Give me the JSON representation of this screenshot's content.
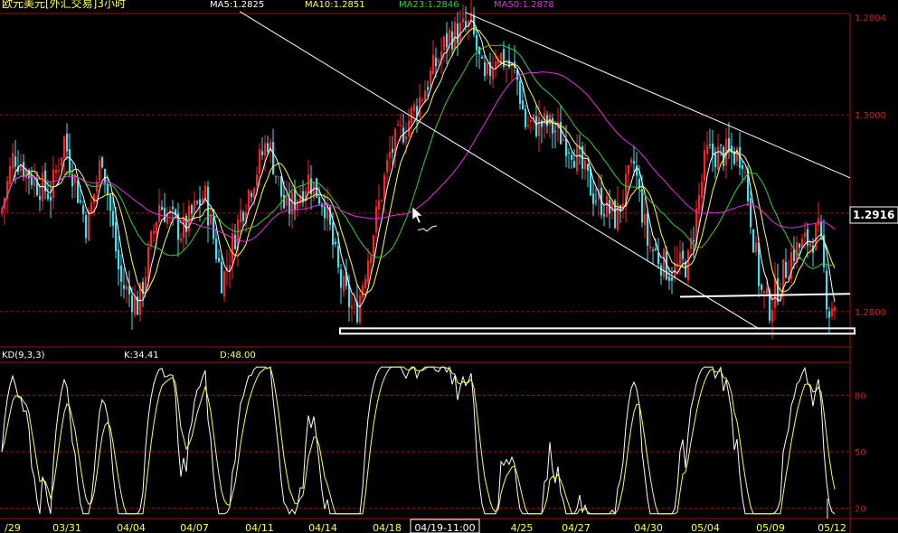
{
  "header": {
    "title": "欧元美元[外汇交易]3小时",
    "ma5": "MA5:1.2825",
    "ma10": "MA10:1.2851",
    "ma23": "MA23:1.2846",
    "ma50": "MA50:1.2878"
  },
  "kd_header": {
    "label": "KD(9,3,3)",
    "k": "K:34.41",
    "d": "D:48.00"
  },
  "colors": {
    "background": "#000000",
    "up": "#ff2020",
    "down": "#40e0f0",
    "ma5": "#ffffff",
    "ma10": "#ffff40",
    "ma23": "#30d030",
    "ma50": "#e030e0",
    "grid": "#a01010",
    "axis_text": "#c02020",
    "trendline": "#ffffff"
  },
  "cursor_label": "04/19-11:00",
  "chart_data": [
    {
      "type": "candlestick",
      "title": "欧元美元[外汇交易]3小时",
      "y_ticks": [
        "1.3000",
        "1.2800"
      ],
      "y_tick_values": [
        1.3,
        1.28
      ],
      "ylim": [
        1.2765,
        1.3102
      ],
      "price_labels": {
        "top": "1.2804",
        "current": "1.2916"
      },
      "x_ticks": [
        "/29",
        "03/31",
        "04/04",
        "04/07",
        "04/11",
        "04/14",
        "04/18",
        "04/19-11:00",
        "4/25",
        "04/27",
        "04/30",
        "05/04",
        "05/09",
        "05/12"
      ],
      "anchors": [
        [
          0,
          1.29
        ],
        [
          14,
          1.296
        ],
        [
          40,
          1.293
        ],
        [
          55,
          1.292
        ],
        [
          70,
          1.2975
        ],
        [
          95,
          1.2885
        ],
        [
          112,
          1.296
        ],
        [
          132,
          1.283
        ],
        [
          152,
          1.2805
        ],
        [
          175,
          1.291
        ],
        [
          200,
          1.288
        ],
        [
          225,
          1.292
        ],
        [
          245,
          1.283
        ],
        [
          265,
          1.29
        ],
        [
          295,
          1.2975
        ],
        [
          315,
          1.29
        ],
        [
          340,
          1.2935
        ],
        [
          358,
          1.291
        ],
        [
          375,
          1.283
        ],
        [
          392,
          1.2795
        ],
        [
          402,
          1.284
        ],
        [
          430,
          1.296
        ],
        [
          460,
          1.301
        ],
        [
          495,
          1.308
        ],
        [
          520,
          1.309
        ],
        [
          535,
          1.303
        ],
        [
          548,
          1.3065
        ],
        [
          570,
          1.304
        ],
        [
          580,
          1.299
        ],
        [
          605,
          1.299
        ],
        [
          630,
          1.297
        ],
        [
          655,
          1.292
        ],
        [
          680,
          1.2895
        ],
        [
          700,
          1.295
        ],
        [
          715,
          1.287
        ],
        [
          740,
          1.284
        ],
        [
          760,
          1.285
        ],
        [
          780,
          1.296
        ],
        [
          805,
          1.296
        ],
        [
          820,
          1.296
        ],
        [
          840,
          1.282
        ],
        [
          850,
          1.2805
        ],
        [
          875,
          1.286
        ],
        [
          905,
          1.288
        ],
        [
          915,
          1.28
        ],
        [
          922,
          1.281
        ]
      ],
      "trendlines": [
        {
          "name": "upper-channel",
          "from": [
            515,
            1.3104
          ],
          "to": [
            940,
            1.2936
          ]
        },
        {
          "name": "middle-channel",
          "from": [
            265,
            1.3105
          ],
          "to": [
            840,
            1.2782
          ]
        },
        {
          "name": "support-line",
          "from": [
            752,
            1.2815
          ],
          "to": [
            940,
            1.2818
          ]
        }
      ],
      "highlight_box": {
        "from": [
          376,
          1.2783
        ],
        "to": [
          945,
          1.2779
        ]
      }
    },
    {
      "type": "line",
      "title": "KD(9,3,3)",
      "y_ticks": [
        "80",
        "50",
        "20"
      ],
      "y_tick_values": [
        80,
        50,
        20
      ],
      "ylim": [
        15,
        97
      ],
      "series": [
        {
          "name": "K",
          "latest": 34.41
        },
        {
          "name": "D",
          "latest": 48.0
        }
      ]
    }
  ]
}
